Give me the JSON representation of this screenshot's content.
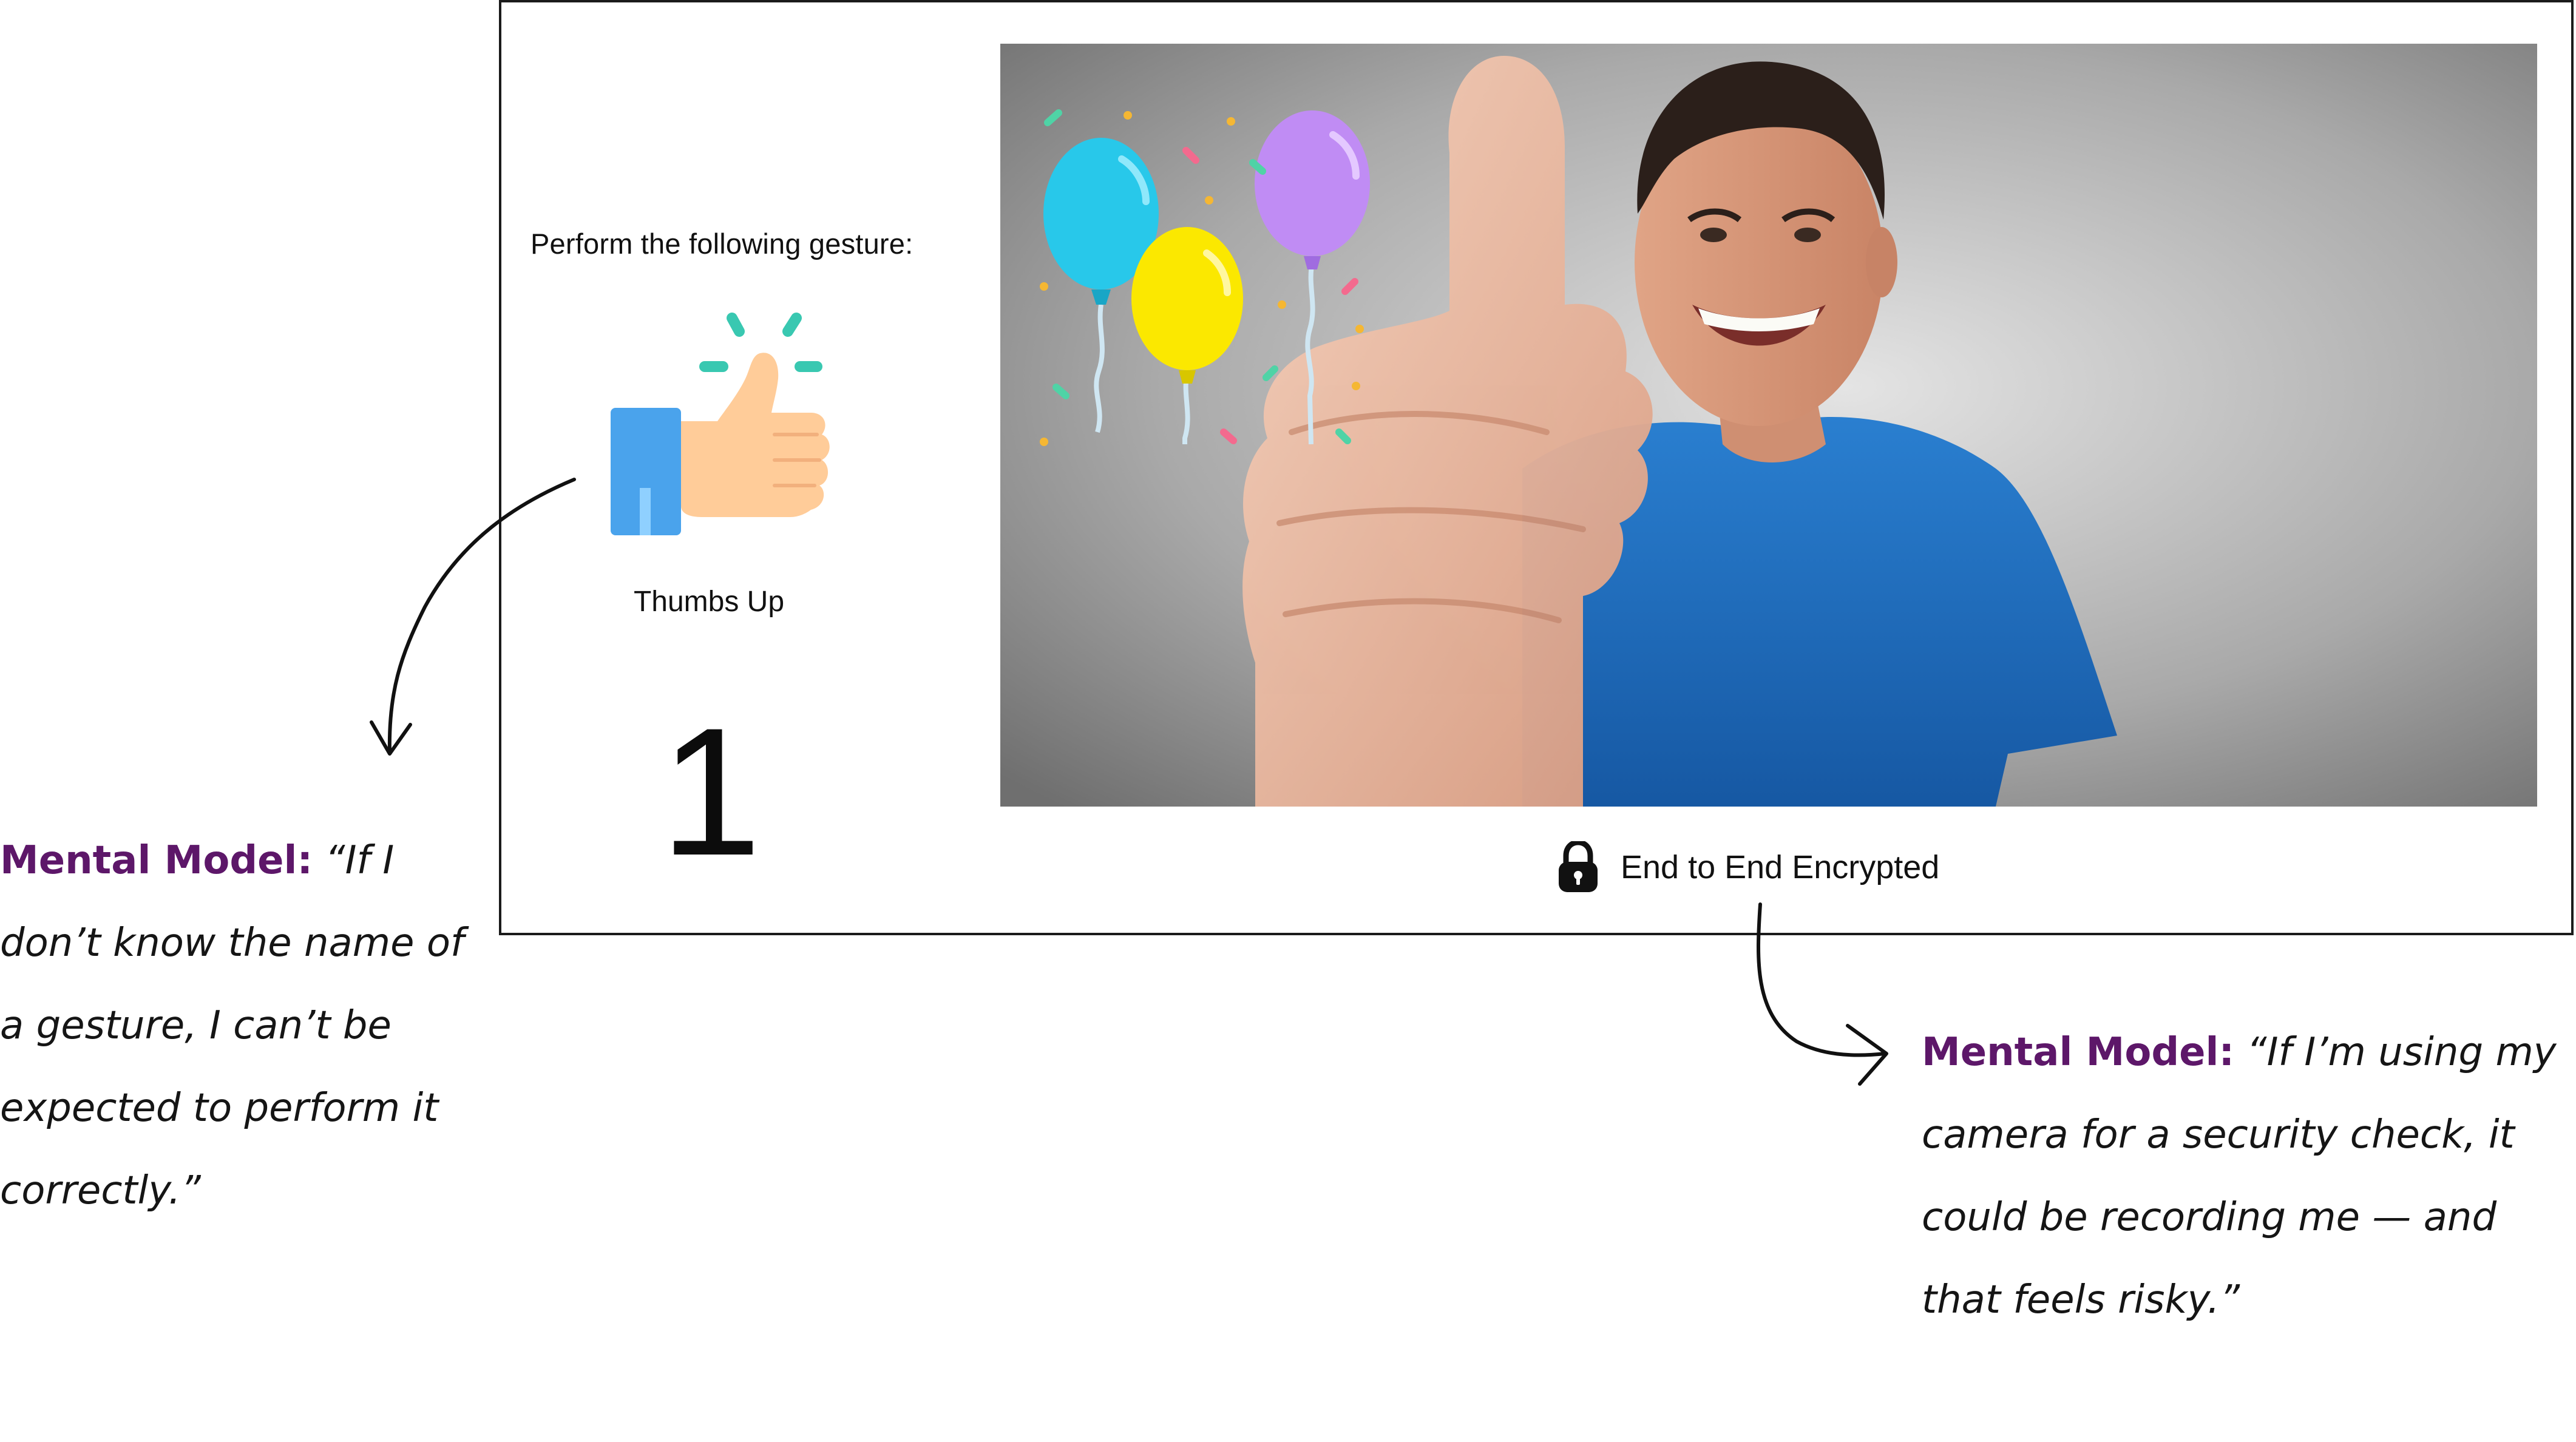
{
  "challenge": {
    "prompt": "Perform the following gesture:",
    "gesture_icon": "thumbs-up-icon",
    "gesture_name": "Thumbs Up",
    "countdown": "1",
    "camera_overlay": "balloons-confetti",
    "encryption_icon": "lock-icon",
    "encryption_label": "End to End Encrypted"
  },
  "annotations": {
    "left": {
      "label": "Mental Model:",
      "quote": "“If I don’t know the name of a gesture, I can’t be expected to perform it correctly.”"
    },
    "right": {
      "label": "Mental Model:",
      "quote": "“If I’m using my camera for a security check, it could be recording me — and that feels risky.”"
    }
  },
  "colors": {
    "accent_purple": "#5d1769",
    "frame_border": "#1b1b1b",
    "shirt_blue": "#1f6fc0",
    "thumb_sleeve": "#4aa3ec",
    "thumb_skin": "#ffcc99"
  }
}
